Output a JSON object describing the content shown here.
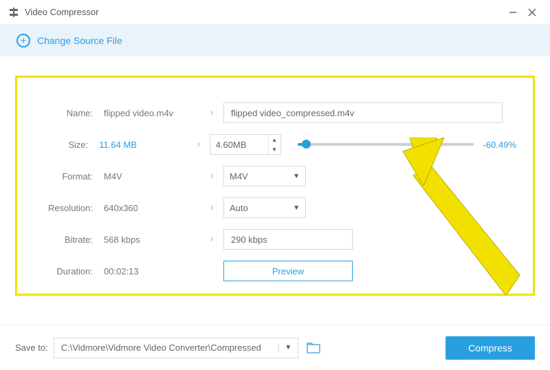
{
  "window": {
    "title": "Video Compressor"
  },
  "topbar": {
    "change_source_label": "Change Source File"
  },
  "form": {
    "name": {
      "label": "Name:",
      "original": "flipped video.m4v",
      "output": "flipped video_compressed.m4v"
    },
    "size": {
      "label": "Size:",
      "original": "11.64 MB",
      "output": "4.60MB",
      "percent": "-60.49%"
    },
    "format": {
      "label": "Format:",
      "original": "M4V",
      "output": "M4V"
    },
    "resolution": {
      "label": "Resolution:",
      "original": "640x360",
      "output": "Auto"
    },
    "bitrate": {
      "label": "Bitrate:",
      "original": "568 kbps",
      "output": "290 kbps"
    },
    "duration": {
      "label": "Duration:",
      "value": "00:02:13"
    },
    "preview_label": "Preview"
  },
  "bottom": {
    "save_to_label": "Save to:",
    "path": "C:\\Vidmore\\Vidmore Video Converter\\Compressed",
    "compress_label": "Compress"
  }
}
